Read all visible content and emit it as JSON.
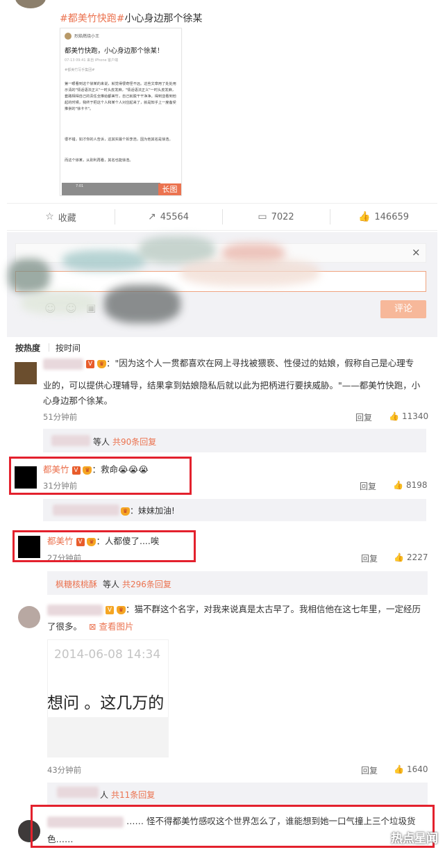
{
  "post": {
    "hashtag": "#都美竹快跑#",
    "text": "小心身边那个徐某",
    "thumb_author": "烈焰燃烧小王",
    "thumb_title": "都美竹快跑，小心身边那个徐某！",
    "thumb_meta": "07-13 09:41 来自 iPhone 客户端",
    "thumb_tag": "#都美竹写手集团#",
    "thumb_para1": "第一眼看到这个徐某的来说，就觉得很奇怪不远。这些文章用了处处用示清的\"情话语法正义\"一时头皮发麻，\"情话语法正义\"一时头皮发麻，套路相得自己的责任全推给都美竹，自己就脱干干净净。得到亚看到他起的时候，我终于把这个人和某个人对应起来了，就是知乎上一度备受推崇的\"徐卡卡\"。",
    "thumb_para2": "很不错，如才你的人告诉，这其实最个拆李浩，因为他其名是徐浩。",
    "thumb_para3": "而这个徐某，从别利再看，其名也能徐浩。",
    "thumb_bar": "7:01",
    "long_badge": "长图"
  },
  "actions": {
    "favorite_icon": "star-icon",
    "favorite": "收藏",
    "forward_icon": "share-icon",
    "forward": "45564",
    "comment_icon": "comment-icon",
    "comment": "7022",
    "like_icon": "thumbs-up-icon",
    "like": "146659"
  },
  "composer": {
    "close": "×",
    "submit": "评论"
  },
  "sort": {
    "hot": "按热度",
    "time": "按时间"
  },
  "comments": {
    "c1": {
      "text_line1": "：\"因为这个人一贯都喜欢在网上寻找被猥亵、性侵过的姑娘，假称自己是心理专",
      "text_line2": "业的，可以提供心理辅导，结果拿到姑娘隐私后就以此为把柄进行要挟威胁。\"——都美竹快跑，小",
      "text_line3": "心身边那个徐某。",
      "time": "51分钟前",
      "reply": "回复",
      "likes": "11340",
      "sub_suffix": "等人",
      "sub_count": "共90条回复"
    },
    "c2": {
      "name": "都美竹",
      "text": "：救命😭😭😭",
      "time": "31分钟前",
      "reply": "回复",
      "likes": "8198",
      "sub_text": "：妹妹加油!"
    },
    "c3": {
      "name": "都美竹",
      "text": "：人都傻了....唉",
      "time": "27分钟前",
      "reply": "回复",
      "likes": "2227",
      "sub_name": "枫糖核桃酥",
      "sub_suffix": "等人",
      "sub_count": "共296条回复"
    },
    "c4": {
      "text_line1": "：猫不群这个名字，对我来说真是太古早了。我相信他在这七年里，一定经历",
      "text_line2": "了很多。",
      "view_pic": "查看图片",
      "pic_date": "2014-06-08 14:34",
      "pic_text": "想问 。这几万的",
      "time": "43分钟前",
      "reply": "回复",
      "likes": "1640",
      "sub_suffix": "人",
      "sub_count": "共11条回复"
    },
    "c5": {
      "text_line1": "…… 怪不得都美竹感叹这个世界怎么了，谁能想到她一口气撞上三个垃圾货",
      "text_line2": "色……"
    }
  },
  "watermark": "热点星闻"
}
